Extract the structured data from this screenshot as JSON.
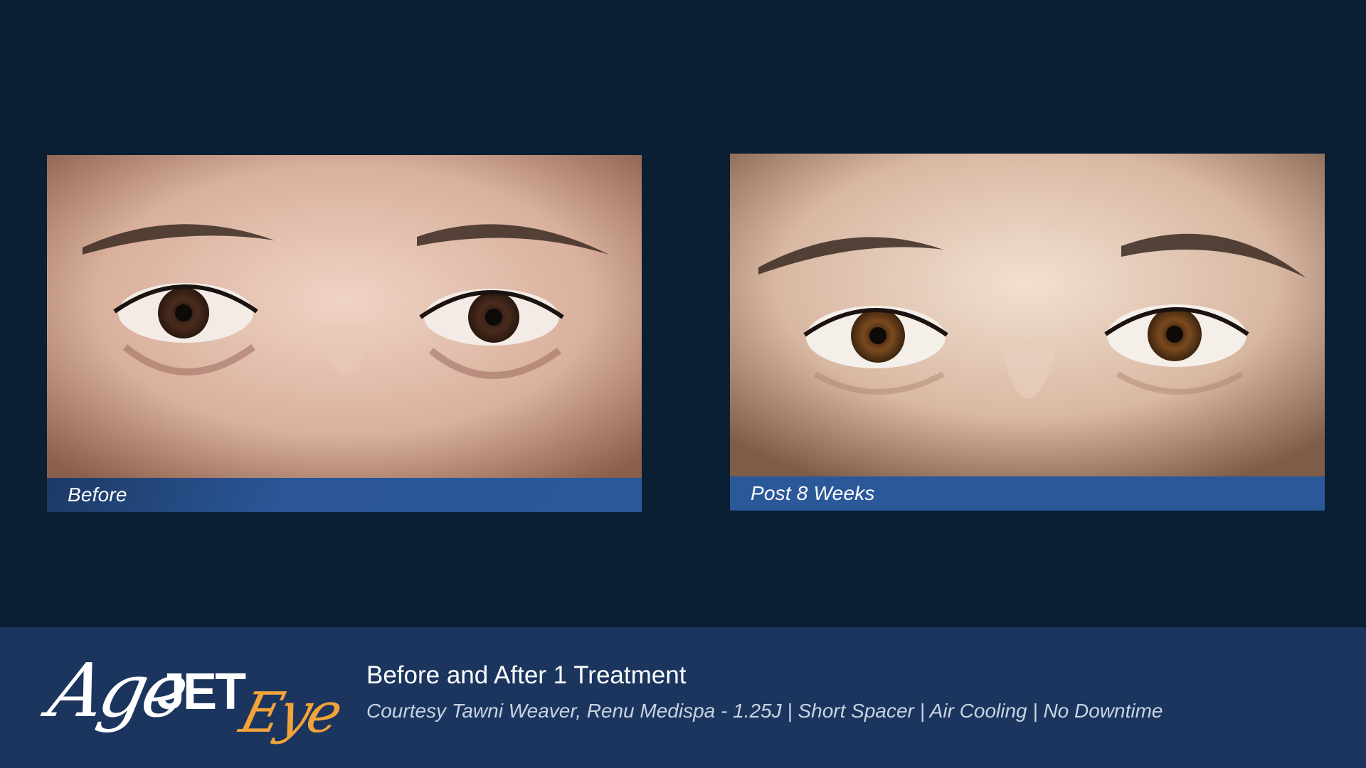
{
  "panels": {
    "before": {
      "caption": "Before"
    },
    "after": {
      "caption": "Post 8 Weeks"
    }
  },
  "logo": {
    "script_part": "Age",
    "bold_part": "JET",
    "accent_part": "Eye",
    "accent_color": "#f2a33a"
  },
  "footer": {
    "title": "Before and After 1 Treatment",
    "subtitle": "Courtesy Tawni Weaver, Renu Medispa -  1.25J  |  Short Spacer  |  Air Cooling  | No Downtime"
  },
  "colors": {
    "background": "#0a1e34",
    "caption_bar": "#2b5899",
    "footer_bg": "#1b355e"
  }
}
